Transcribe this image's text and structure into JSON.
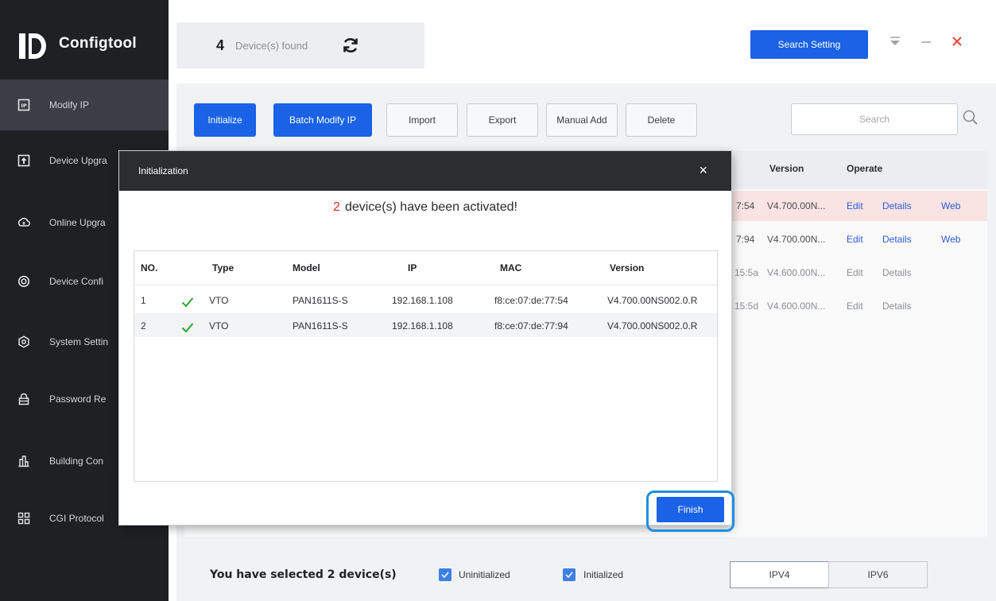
{
  "app": {
    "name": "Configtool",
    "logo_text": "D"
  },
  "sidebar": {
    "items": [
      {
        "label": "Modify IP",
        "icon": "ip-icon",
        "active": true
      },
      {
        "label": "Device Upgra",
        "icon": "upload-icon"
      },
      {
        "label": "Online Upgra",
        "icon": "cloud-upgrade-icon"
      },
      {
        "label": "Device Confi",
        "icon": "target-icon"
      },
      {
        "label": "System Settin",
        "icon": "gear-hex-icon"
      },
      {
        "label": "Password Re",
        "icon": "lock-icon"
      },
      {
        "label": "Building Con",
        "icon": "building-icon"
      },
      {
        "label": "CGI Protocol",
        "icon": "grid-icon"
      }
    ]
  },
  "header": {
    "found_count": "4",
    "found_label": "Device(s) found",
    "search_setting_label": "Search Setting",
    "accent_color": "#1a62e6"
  },
  "toolbar": {
    "initialize": "Initialize",
    "batch_modify_ip": "Batch Modify IP",
    "import": "Import",
    "export": "Export",
    "manual_add": "Manual Add",
    "delete": "Delete",
    "search_placeholder": "Search"
  },
  "device_table": {
    "columns": [
      "Version",
      "Operate"
    ],
    "rows": [
      {
        "mac_tail": "7:54",
        "version": "V4.700.00N...",
        "edit": "Edit",
        "details": "Details",
        "web": "Web"
      },
      {
        "mac_tail": "7:94",
        "version": "V4.700.00N...",
        "edit": "Edit",
        "details": "Details",
        "web": "Web"
      },
      {
        "mac_tail": "15:5a",
        "version": "V4.600.00N...",
        "edit": "Edit",
        "details": "Details",
        "web": ""
      },
      {
        "mac_tail": "15:5d",
        "version": "V4.600.00N...",
        "edit": "Edit",
        "details": "Details",
        "web": ""
      }
    ]
  },
  "bottom": {
    "selected_text": "You have selected 2 device(s)",
    "uninitialized_label": "Uninitialized",
    "initialized_label": "Initialized",
    "ipv4": "IPV4",
    "ipv6": "IPV6"
  },
  "dialog": {
    "title": "Initialization",
    "close": "×",
    "message_count": "2",
    "message_text": "device(s) have been activated!",
    "columns": [
      "NO.",
      "Type",
      "Model",
      "IP",
      "MAC",
      "Version"
    ],
    "rows": [
      {
        "no": "1",
        "type": "VTO",
        "model": "PAN1611S-S",
        "ip": "192.168.1.108",
        "mac": "f8:ce:07:de:77:54",
        "version": "V4.700.00NS002.0.R"
      },
      {
        "no": "2",
        "type": "VTO",
        "model": "PAN1611S-S",
        "ip": "192.168.1.108",
        "mac": "f8:ce:07:de:77:94",
        "version": "V4.700.00NS002.0.R"
      }
    ],
    "finish_label": "Finish",
    "success_color": "#2fa52f",
    "highlight_color": "#1e8fe0"
  }
}
